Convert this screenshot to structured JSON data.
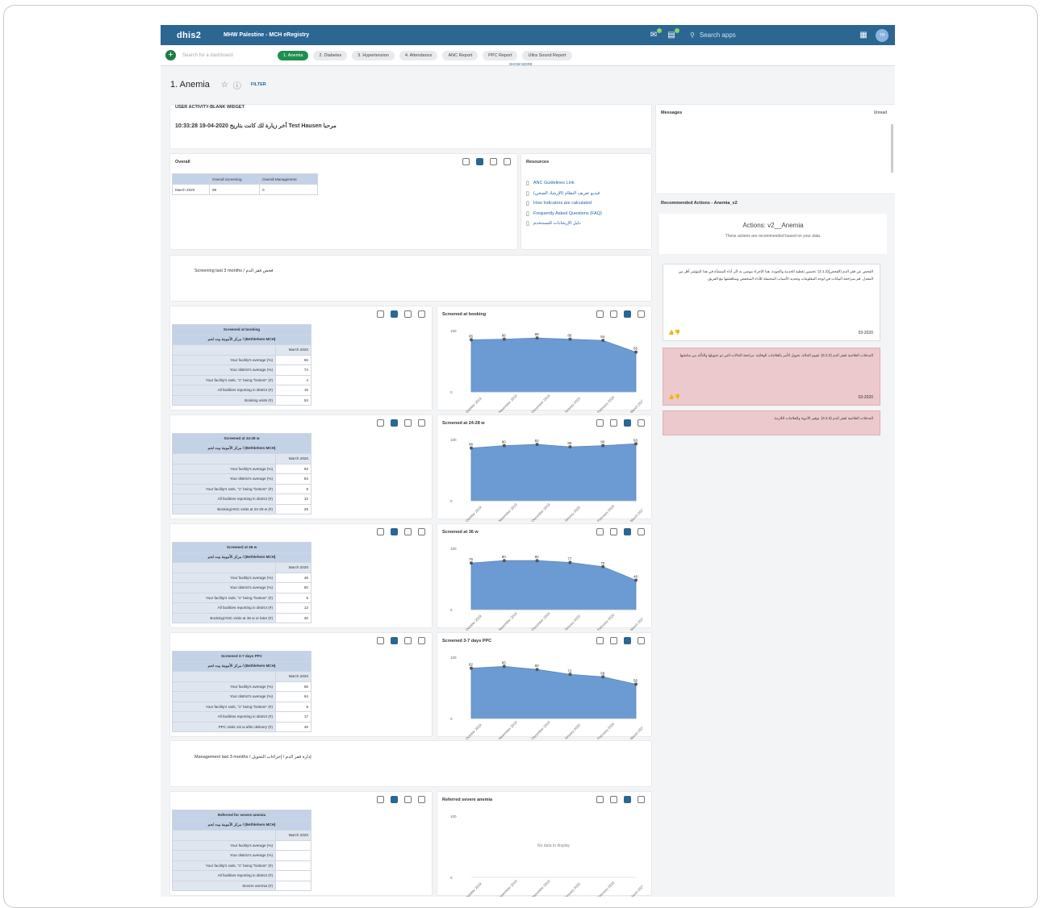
{
  "topbar": {
    "logo": "dhis2",
    "title": "MHW Palestine - MCH eRegistry",
    "search_placeholder": "Search apps",
    "avatar": "TH"
  },
  "dashbar": {
    "search_placeholder": "Search for a dashboard",
    "tabs": [
      "1. Anemia",
      "2. Diabetes",
      "3. Hypertension",
      "4. Attendance",
      "ANC Report",
      "PPC Report",
      "Ultra Sound Report"
    ],
    "show_more": "SHOW MORE"
  },
  "dashboard": {
    "title": "1. Anemia",
    "filter": "FILTER"
  },
  "user_activity": {
    "title": "USER ACTIVITY-BLANK WIDGET",
    "text": "مرحبا Test Hausen آخر زيارة لك كانت بتاريخ 2020-04-19 10:33:28"
  },
  "overall": {
    "title": "Overall",
    "headers": [
      "Overall Screening",
      "Overall Management"
    ],
    "row_label": "March 2020",
    "values": [
      "99",
      "0"
    ]
  },
  "resources": {
    "title": "Resources",
    "items": [
      "ANC Guidelines Link",
      "فيديو تعريف النظام (الإرشاد الصحي)",
      "How Indicators are calculated",
      "Frequently Asked Questions (FAQ)",
      "دليل الإرشادات للمستخدم"
    ]
  },
  "messages": {
    "title": "Messages",
    "view": "Unread"
  },
  "recommended": {
    "title": "Recommended Actions - Anemia_v2",
    "heading": "Actions: v2__Anemia",
    "sub": "These actions are recommended based on your data.",
    "items": [
      {
        "text": "الفحص عن فقر الدم (الفحص)(2.1.2): تحسين تغطية الخدمة والجودة. هذا الإجراء موصى به لأن أداء المنشأة في هذا المؤشر أقل من المعدل. قم بمراجعة البيانات في لوحة المعلومات وتحديد الأسباب المحتملة للأداء المنخفض ومناقشتها مع الفريق.",
        "date": "03-2020"
      },
      {
        "text": "التدخلات العلاجية لفقر الدم (4.2.2): تقييم الحالة، تحويل الأمر بالعلاجات الوقائية. مراجعة الحالات التي تم تحويلها والتأكد من متابعتها.",
        "date": "03-2020"
      },
      {
        "text": "التدخلات العلاجية لفقر الدم (4.2.3): توفير الأدوية والعلاجات اللازمة.",
        "date": ""
      }
    ]
  },
  "sections": {
    "screening": "فحص فقر الدم / Screening last 3 months",
    "management": "إدارة فقر الدم / إجراءات التحويل / Management last 3 months"
  },
  "pivots": [
    {
      "title": "Screened at booking",
      "facility": "مركز الأمومة بيت لحم / (Bethlehem MCH)",
      "period": "March 2020",
      "rows": [
        "Your facility's average (%)",
        "Your district's average (%)",
        "Your facility's rank, \"1\" being \"bottom\" (#)",
        "All facilities reporting in district (#)",
        "Booking visits (#)"
      ],
      "values": [
        "65",
        "74",
        "4",
        "15",
        "53"
      ]
    },
    {
      "title": "Screened at 24-28 w",
      "facility": "مركز الأمومة بيت لحم / (Bethlehem MCH)",
      "period": "March 2020",
      "rows": [
        "Your facility's average (%)",
        "Your district's average (%)",
        "Your facility's rank, \"1\" being \"bottom\" (#)",
        "All facilities reporting in district (#)",
        "Booking/ANC visits at 24-28 w (#)"
      ],
      "values": [
        "93",
        "84",
        "8",
        "10",
        "29"
      ]
    },
    {
      "title": "Screened at 36 w",
      "facility": "مركز الأمومة بيت لحم / (Bethlehem MCH)",
      "period": "March 2020",
      "rows": [
        "Your facility's average (%)",
        "Your district's average (%)",
        "Your facility's rank, \"1\" being \"bottom\" (#)",
        "All facilities reporting in district (#)",
        "Booking/ANC visits at 36 w or later (#)"
      ],
      "values": [
        "48",
        "50",
        "5",
        "13",
        "30"
      ]
    },
    {
      "title": "Screened 3-7 days PPC",
      "facility": "مركز الأمومة بيت لحم / (Bethlehem MCH)",
      "period": "March 2020",
      "rows": [
        "Your facility's average (%)",
        "Your district's average (%)",
        "Your facility's rank, \"1\" being \"bottom\" (#)",
        "All facilities reporting in district (#)",
        "PPC visits 1st w after delivery (#)"
      ],
      "values": [
        "56",
        "64",
        "5",
        "17",
        "46"
      ]
    },
    {
      "title": "Referred for severe anemia",
      "facility": "مركز الأمومة بيت لحم / (Bethlehem MCH)",
      "period": "March 2020",
      "rows": [
        "Your facility's average (%)",
        "Your district's average (%)",
        "Your facility's rank, \"1\" being \"bottom\" (#)",
        "All facilities reporting in district (#)",
        "Severe anemia (#)"
      ],
      "values": [
        "",
        "",
        "",
        "",
        ""
      ]
    }
  ],
  "chart_data": [
    {
      "type": "area",
      "title": "Screened at booking",
      "x": [
        "October 2019",
        "November 2019",
        "December 2019",
        "January 2020",
        "February 2020",
        "March 2020"
      ],
      "values": [
        85,
        86,
        88,
        86,
        84,
        65
      ],
      "ylim": [
        0,
        100
      ],
      "y_ticks": [
        "0",
        "100"
      ],
      "grid": false,
      "no_data": ""
    },
    {
      "type": "area",
      "title": "Screened at 24-28 w",
      "x": [
        "October 2019",
        "November 2019",
        "December 2019",
        "January 2020",
        "February 2020",
        "March 2020"
      ],
      "values": [
        86,
        90,
        92,
        88,
        90,
        93
      ],
      "ylim": [
        0,
        100
      ],
      "y_ticks": [
        "0",
        "100"
      ],
      "grid": false,
      "no_data": ""
    },
    {
      "type": "area",
      "title": "Screened at 36 w",
      "x": [
        "October 2019",
        "November 2019",
        "December 2019",
        "January 2020",
        "February 2020",
        "March 2020"
      ],
      "values": [
        76,
        80,
        80,
        77,
        70,
        48
      ],
      "ylim": [
        0,
        100
      ],
      "y_ticks": [
        "0",
        "100"
      ],
      "grid": false,
      "no_data": ""
    },
    {
      "type": "area",
      "title": "Screened 3-7 days PPC",
      "x": [
        "October 2019",
        "November 2019",
        "December 2019",
        "January 2020",
        "February 2020",
        "March 2020"
      ],
      "values": [
        82,
        85,
        80,
        72,
        68,
        56
      ],
      "ylim": [
        0,
        100
      ],
      "y_ticks": [
        "0",
        "100"
      ],
      "grid": false,
      "no_data": ""
    },
    {
      "type": "area",
      "title": "Referred severe anemia",
      "x": [
        "October 2019",
        "November 2019",
        "December 2019",
        "January 2020",
        "February 2020",
        "March 2020"
      ],
      "values": [],
      "ylim": [
        0,
        100
      ],
      "y_ticks": [
        "0",
        "100"
      ],
      "grid": false,
      "no_data": "No data to display"
    }
  ]
}
